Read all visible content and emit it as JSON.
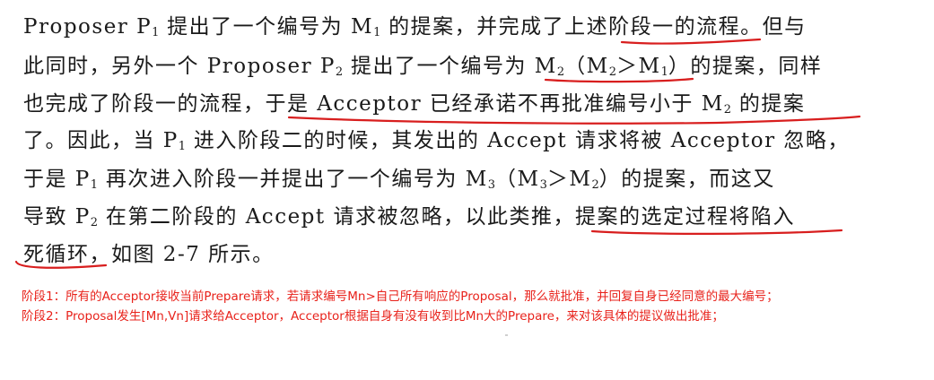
{
  "text": {
    "l1": [
      "Proposer P",
      "1",
      " 提出了一个编号为 M",
      "1",
      " 的提案，并完成了上述阶段一的流程。但与"
    ],
    "l2": [
      "此同时，另外一个 Proposer P",
      "2",
      " 提出了一个编号为 M",
      "2",
      "（M",
      "2",
      "＞M",
      "1",
      "）的提案，同样"
    ],
    "l3": [
      "也完成了阶段一的流程，于是 Acceptor 已经承诺不再批准编号小于 M",
      "2",
      " 的提案"
    ],
    "l4": [
      "了。因此，当 P",
      "1",
      " 进入阶段二的时候，其发出的 Accept 请求将被 Acceptor 忽略，"
    ],
    "l5": [
      "于是 P",
      "1",
      " 再次进入阶段一并提出了一个编号为 M",
      "3",
      "（M",
      "3",
      "＞M",
      "2",
      "）的提案，而这又"
    ],
    "l6": [
      "导致 P",
      "2",
      " 在第二阶段的 Accept 请求被忽略，以此类推，提案的选定过程将陷入"
    ],
    "l7": [
      "死循环，如图 2-7 所示。"
    ]
  },
  "notes": {
    "n1": "阶段1：所有的Acceptor接收当前Prepare请求，若请求编号Mn>自己所有响应的Proposal，那么就批准，并回复自身已经同意的最大编号；",
    "n2": "阶段2：Proposal发生[Mn,Vn]请求给Acceptor，Acceptor根据自身有没有收到比Mn大的Prepare，来对该具体的提议做出批准；"
  },
  "colors": {
    "annotation": "#e8221b",
    "underline": "#d81e1e",
    "body_text": "#1a1a1a"
  }
}
